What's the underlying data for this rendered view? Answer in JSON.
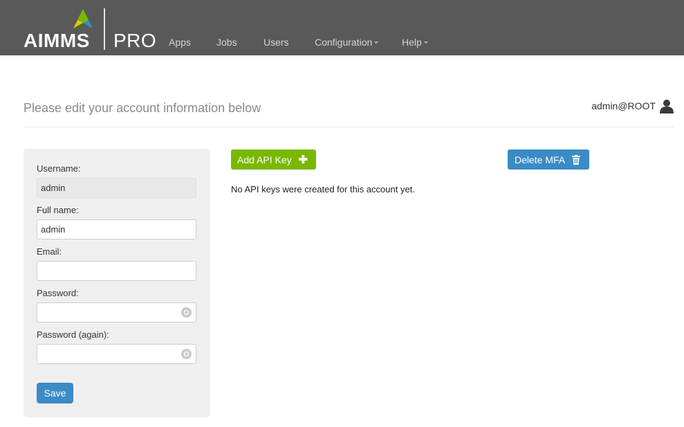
{
  "brand": {
    "name": "AIMMS",
    "product": "PRO"
  },
  "nav": {
    "items": [
      {
        "label": "Apps"
      },
      {
        "label": "Jobs"
      },
      {
        "label": "Users"
      },
      {
        "label": "Configuration",
        "dropdown": true
      },
      {
        "label": "Help",
        "dropdown": true
      }
    ]
  },
  "header": {
    "heading": "Please edit your account information below",
    "user": "admin@ROOT",
    "user_icon": "user-icon"
  },
  "form": {
    "username_label": "Username:",
    "username_value": "admin",
    "fullname_label": "Full name:",
    "fullname_value": "admin",
    "email_label": "Email:",
    "email_value": "",
    "password_label": "Password:",
    "password_value": "",
    "password_again_label": "Password (again):",
    "password_again_value": "",
    "save_label": "Save"
  },
  "api": {
    "add_label": "Add API Key",
    "add_icon": "plus-icon",
    "delete_mfa_label": "Delete MFA",
    "delete_icon": "trash-icon",
    "empty_message": "No API keys were created for this account yet."
  },
  "colors": {
    "navbar": "#595959",
    "green": "#7ab800",
    "blue": "#3a8bc6",
    "panel": "#efefef"
  }
}
